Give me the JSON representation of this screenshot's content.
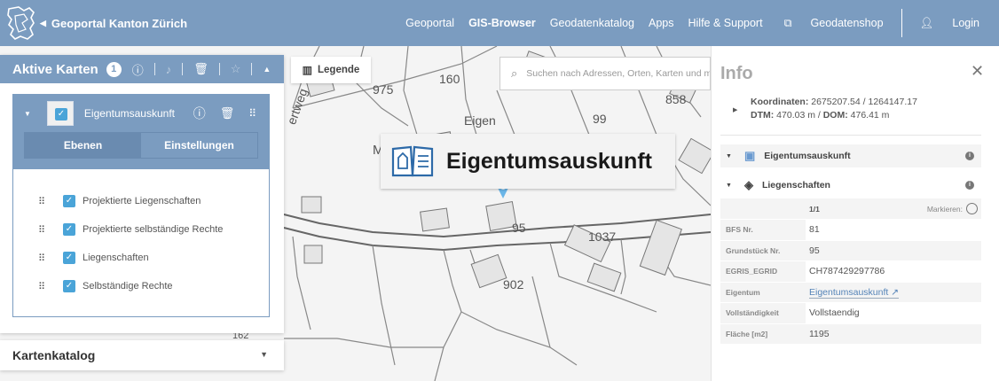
{
  "header": {
    "brand": "Geoportal Kanton Zürich",
    "nav": [
      "Geoportal",
      "GIS-Browser",
      "Geodatenkatalog",
      "Apps",
      "Hilfe & Support",
      "Geodatenshop",
      "Login"
    ],
    "nav_active": "GIS-Browser",
    "bg_color": "#7b9cc0"
  },
  "active_maps": {
    "title": "Aktive Karten",
    "count": "1",
    "map_item": {
      "name": "Eigentumsauskunft",
      "tabs": [
        "Ebenen",
        "Einstellungen"
      ],
      "layers": [
        "Projektierte Liegenschaften",
        "Projektierte selbständige Rechte",
        "Liegenschaften",
        "Selbständige Rechte"
      ]
    }
  },
  "catalog": {
    "title": "Kartenkatalog"
  },
  "legend": {
    "label": "Legende"
  },
  "search": {
    "placeholder": "Suchen nach Adressen, Orten, Karten und meh"
  },
  "map_overlay": {
    "title": "Eigentumsauskunft"
  },
  "map_labels": {
    "parcels": [
      "975",
      "160",
      "Eigen",
      "99",
      "858",
      "95",
      "1037",
      "902",
      "162"
    ],
    "street_1": "Mu",
    "street_2": "ertweg"
  },
  "info": {
    "title": "Info",
    "coord_label": "Koordinaten:",
    "coord_value": "2675207.54 / 1264147.17",
    "dtm_label": "DTM:",
    "dtm_value": "470.03 m",
    "dom_label": "DOM:",
    "dom_value": "476.41 m",
    "sections": [
      "Eigentumsauskunft",
      "Liegenschaften"
    ],
    "pager": "1/1",
    "mark_label": "Markieren:",
    "attributes": [
      {
        "key": "BFS Nr.",
        "value": "81"
      },
      {
        "key": "Grundstück Nr.",
        "value": "95"
      },
      {
        "key": "EGRIS_EGRID",
        "value": "CH787429297786"
      },
      {
        "key": "Eigentum",
        "value": "Eigentumsauskunft ↗"
      },
      {
        "key": "Vollständigkeit",
        "value": "Vollstaendig"
      },
      {
        "key": "Fläche [m2]",
        "value": "1195"
      }
    ]
  },
  "colors": {
    "accent": "#7b9cc0",
    "checkbox": "#4aa4d8",
    "link": "#5584b8"
  }
}
